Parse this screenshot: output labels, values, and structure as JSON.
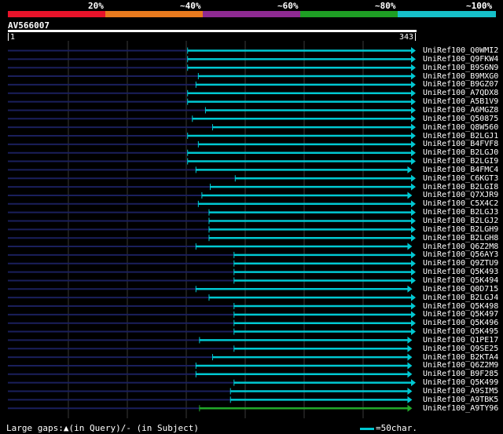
{
  "scale": {
    "labels": [
      "20%",
      "~40%",
      "~60%",
      "~80%",
      "~100%"
    ],
    "colors": [
      "#e8132a",
      "#e87a1e",
      "#8e2a92",
      "#1e9e24",
      "#16c0c9"
    ]
  },
  "query": {
    "id": "AV566007",
    "start": "1",
    "end": "343",
    "length": 343
  },
  "hits": [
    {
      "label": "UniRef100_Q0WMI2",
      "start": 152,
      "end": 343,
      "color": "#00c8d2",
      "arrow": true
    },
    {
      "label": "UniRef100_Q9FKW4",
      "start": 152,
      "end": 343,
      "color": "#00c8d2",
      "arrow": true
    },
    {
      "label": "UniRef100_B9S6N9",
      "start": 152,
      "end": 343,
      "color": "#00c8d2",
      "arrow": true
    },
    {
      "label": "UniRef100_B9MXG0",
      "start": 161,
      "end": 343,
      "color": "#00c8d2",
      "arrow": true
    },
    {
      "label": "UniRef100_B9GZ07",
      "start": 159,
      "end": 343,
      "color": "#00c8d2",
      "arrow": true
    },
    {
      "label": "UniRef100_A7QDX8",
      "start": 152,
      "end": 343,
      "color": "#00c8d2",
      "arrow": true
    },
    {
      "label": "UniRef100_A5B1V9",
      "start": 152,
      "end": 343,
      "color": "#00c8d2",
      "arrow": true
    },
    {
      "label": "UniRef100_A6MGZ8",
      "start": 167,
      "end": 343,
      "color": "#00c8d2",
      "arrow": true
    },
    {
      "label": "UniRef100_Q50875",
      "start": 156,
      "end": 343,
      "color": "#00c8d2",
      "arrow": true
    },
    {
      "label": "UniRef100_Q8W560",
      "start": 173,
      "end": 343,
      "color": "#00c8d2",
      "arrow": true
    },
    {
      "label": "UniRef100_B2LGJ1",
      "start": 152,
      "end": 343,
      "color": "#00c8d2",
      "arrow": true
    },
    {
      "label": "UniRef100_B4FVF8",
      "start": 161,
      "end": 343,
      "color": "#00c8d2",
      "arrow": true
    },
    {
      "label": "UniRef100_B2LGJ0",
      "start": 152,
      "end": 343,
      "color": "#00c8d2",
      "arrow": true
    },
    {
      "label": "UniRef100_B2LGI9",
      "start": 152,
      "end": 343,
      "color": "#00c8d2",
      "arrow": true
    },
    {
      "label": "UniRef100_B4FMC4",
      "start": 159,
      "end": 340,
      "color": "#00c8d2",
      "arrow": true
    },
    {
      "label": "UniRef100_C6KGT3",
      "start": 192,
      "end": 343,
      "color": "#00c8d2",
      "arrow": true
    },
    {
      "label": "UniRef100_B2LGI8",
      "start": 171,
      "end": 343,
      "color": "#00c8d2",
      "arrow": true
    },
    {
      "label": "UniRef100_Q7XJR9",
      "start": 164,
      "end": 340,
      "color": "#00c8d2",
      "arrow": true
    },
    {
      "label": "UniRef100_C5X4C2",
      "start": 161,
      "end": 343,
      "color": "#00c8d2",
      "arrow": true
    },
    {
      "label": "UniRef100_B2LGJ3",
      "start": 170,
      "end": 343,
      "color": "#00c8d2",
      "arrow": true
    },
    {
      "label": "UniRef100_B2LGJ2",
      "start": 170,
      "end": 343,
      "color": "#00c8d2",
      "arrow": true
    },
    {
      "label": "UniRef100_B2LGH9",
      "start": 170,
      "end": 343,
      "color": "#00c8d2",
      "arrow": true
    },
    {
      "label": "UniRef100_B2LGH8",
      "start": 170,
      "end": 343,
      "color": "#00c8d2",
      "arrow": true
    },
    {
      "label": "UniRef100_Q6Z2M8",
      "start": 159,
      "end": 340,
      "color": "#00c8d2",
      "arrow": true
    },
    {
      "label": "UniRef100_Q56AY3",
      "start": 191,
      "end": 343,
      "color": "#00c8d2",
      "arrow": true
    },
    {
      "label": "UniRef100_Q9ZTU9",
      "start": 191,
      "end": 343,
      "color": "#00c8d2",
      "arrow": true
    },
    {
      "label": "UniRef100_Q5K493",
      "start": 191,
      "end": 343,
      "color": "#00c8d2",
      "arrow": true
    },
    {
      "label": "UniRef100_Q5K494",
      "start": 191,
      "end": 343,
      "color": "#00c8d2",
      "arrow": true
    },
    {
      "label": "UniRef100_Q0D715",
      "start": 159,
      "end": 340,
      "color": "#00c8d2",
      "arrow": true
    },
    {
      "label": "UniRef100_B2LGJ4",
      "start": 170,
      "end": 343,
      "color": "#00c8d2",
      "arrow": true
    },
    {
      "label": "UniRef100_Q5K498",
      "start": 191,
      "end": 343,
      "color": "#00c8d2",
      "arrow": true
    },
    {
      "label": "UniRef100_Q5K497",
      "start": 191,
      "end": 343,
      "color": "#00c8d2",
      "arrow": true
    },
    {
      "label": "UniRef100_Q5K496",
      "start": 191,
      "end": 343,
      "color": "#00c8d2",
      "arrow": true
    },
    {
      "label": "UniRef100_Q5K495",
      "start": 191,
      "end": 343,
      "color": "#00c8d2",
      "arrow": true
    },
    {
      "label": "UniRef100_Q1PE17",
      "start": 162,
      "end": 340,
      "color": "#00c8d2",
      "arrow": true
    },
    {
      "label": "UniRef100_Q9SE25",
      "start": 191,
      "end": 340,
      "color": "#00c8d2",
      "arrow": true
    },
    {
      "label": "UniRef100_B2KTA4",
      "start": 173,
      "end": 340,
      "color": "#00c8d2",
      "arrow": true
    },
    {
      "label": "UniRef100_Q6Z2M9",
      "start": 159,
      "end": 340,
      "color": "#00c8d2",
      "arrow": true
    },
    {
      "label": "UniRef100_B9F285",
      "start": 159,
      "end": 340,
      "color": "#00c8d2",
      "arrow": true
    },
    {
      "label": "UniRef100_Q5K499",
      "start": 191,
      "end": 343,
      "color": "#00c8d2",
      "arrow": true
    },
    {
      "label": "UniRef100_A9SIM5",
      "start": 188,
      "end": 340,
      "color": "#00c8d2",
      "arrow": true
    },
    {
      "label": "UniRef100_A9TBK5",
      "start": 188,
      "end": 340,
      "color": "#00c8d2",
      "arrow": true
    },
    {
      "label": "UniRef100_A9TY96",
      "start": 162,
      "end": 340,
      "color": "#22a82a",
      "arrow": true
    }
  ],
  "footer": {
    "gaps_legend": "Large gaps:▲(in Query)/- (in Subject)",
    "scale_legend": "=50char."
  }
}
